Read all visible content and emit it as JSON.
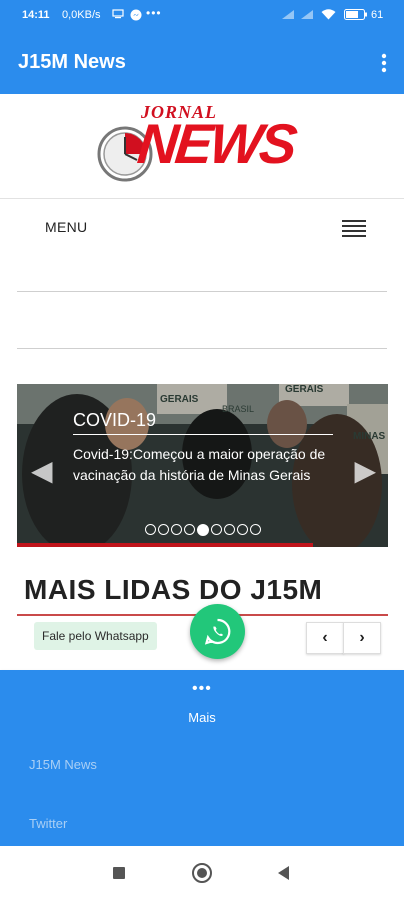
{
  "status_bar": {
    "time": "14:11",
    "network": "0,0KB/s",
    "battery": "61"
  },
  "app_bar": {
    "title": "J15M News"
  },
  "logo": {
    "top_word": "JORNAL",
    "main_word": "NEWS"
  },
  "menu": {
    "label": "MENU"
  },
  "slider": {
    "category": "COVID-19",
    "headline": "Covid-19:Começou a maior operação de vacinação da história de Minas Gerais",
    "slide_count": 9,
    "active_index": 4,
    "photo_texts": [
      "GERAIS",
      "GERAIS",
      "BRASIL",
      "MINAS"
    ]
  },
  "section": {
    "title": "MAIS LIDAS DO J15M"
  },
  "whatsapp": {
    "label": "Fale pelo Whatsapp"
  },
  "bottom_menu": {
    "mais_label": "Mais",
    "links": [
      "J15M News",
      "Twitter"
    ]
  },
  "colors": {
    "primary": "#2b8ced",
    "accent_red": "#c0141b",
    "whatsapp_green": "#22c77a"
  }
}
